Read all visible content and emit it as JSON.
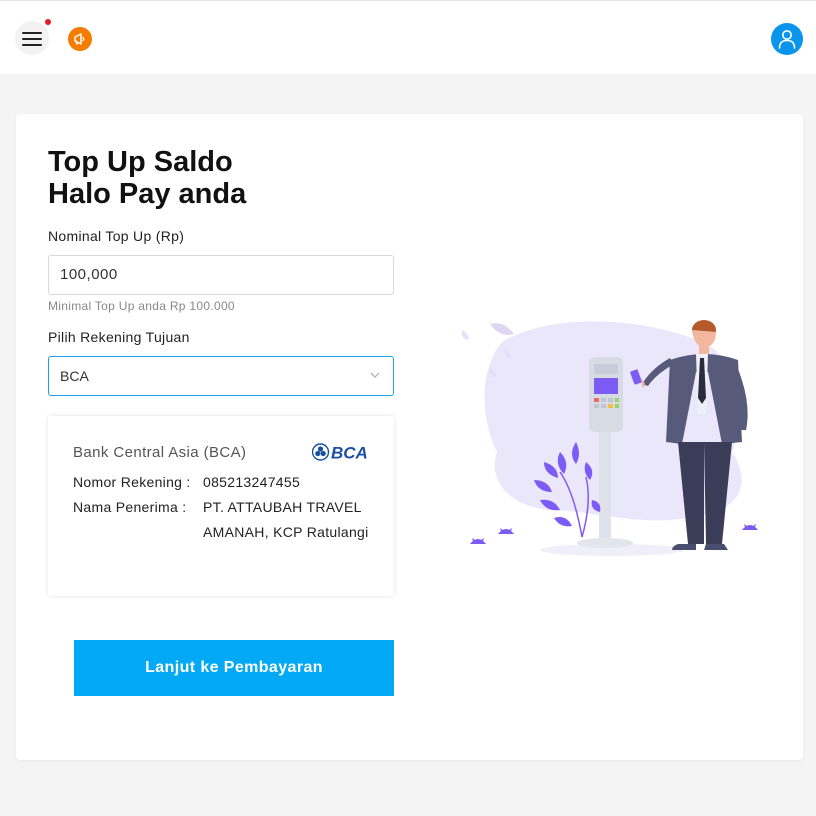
{
  "header": {
    "menu_icon": "hamburger-menu-icon",
    "promo_icon": "megaphone-icon",
    "profile_icon": "user-icon",
    "colors": {
      "promo": "#f57c00",
      "profile": "#0a95ec",
      "notification": "#e21b1b"
    }
  },
  "form": {
    "title_line1": "Top Up Saldo",
    "title_line2": "Halo Pay anda",
    "nominal_label": "Nominal Top Up (Rp)",
    "nominal_value": "100,000",
    "nominal_hint": "Minimal Top Up anda Rp 100.000",
    "rekening_label": "Pilih Rekening Tujuan",
    "rekening_selected": "BCA"
  },
  "bank": {
    "name": "Bank Central Asia (BCA)",
    "logo_text": "BCA",
    "account_number_label": "Nomor Rekening :",
    "account_number": "085213247455",
    "recipient_label": "Nama Penerima :",
    "recipient": "PT. ATTAUBAH TRAVEL AMANAH, KCP Ratulangi"
  },
  "actions": {
    "submit_label": "Lanjut ke Pembayaran",
    "accent": "#03a9f4"
  }
}
